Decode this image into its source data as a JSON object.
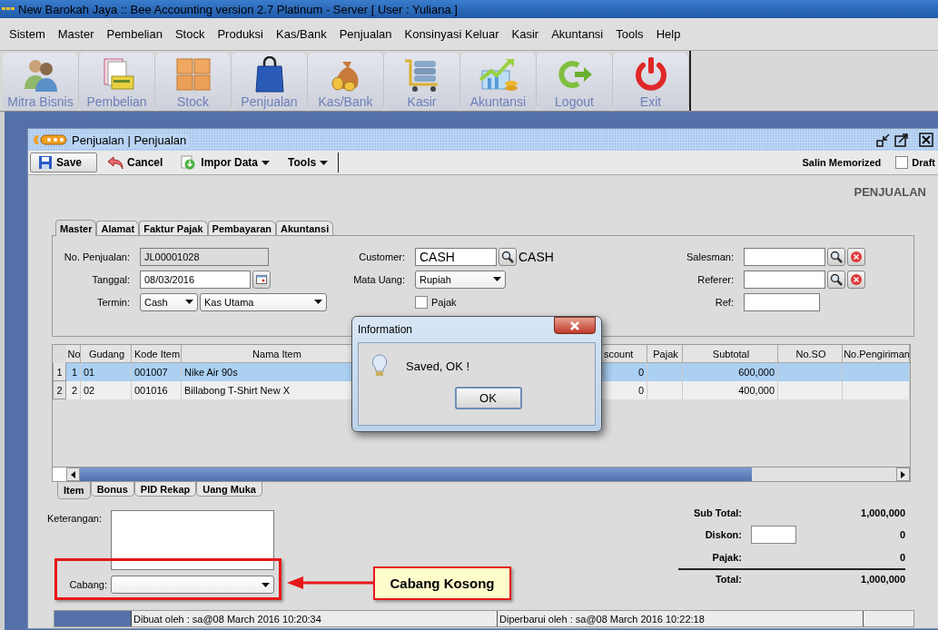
{
  "window": {
    "title": "New Barokah Jaya :: Bee Accounting version 2.7 Platinum - Server  [ User : Yuliana ]"
  },
  "menu": [
    "Sistem",
    "Master",
    "Pembelian",
    "Stock",
    "Produksi",
    "Kas/Bank",
    "Penjualan",
    "Konsinyasi Keluar",
    "Kasir",
    "Akuntansi",
    "Tools",
    "Help"
  ],
  "toolbar": [
    {
      "label": "Mitra Bisnis",
      "kind": "partners"
    },
    {
      "label": "Pembelian",
      "kind": "documents"
    },
    {
      "label": "Stock",
      "kind": "boxes"
    },
    {
      "label": "Penjualan",
      "kind": "bag"
    },
    {
      "label": "Kas/Bank",
      "kind": "money"
    },
    {
      "label": "Kasir",
      "kind": "cart"
    },
    {
      "label": "Akuntansi",
      "kind": "chart"
    },
    {
      "label": "Logout",
      "kind": "logout"
    },
    {
      "label": "Exit",
      "kind": "power"
    }
  ],
  "document": {
    "title": "Penjualan | Penjualan",
    "actions": [
      {
        "label": "Save",
        "kind": "save"
      },
      {
        "label": "Cancel",
        "kind": "cancel"
      },
      {
        "label": "Impor Data",
        "kind": "import"
      },
      {
        "label": "Tools",
        "kind": "menu"
      }
    ],
    "memorized": "Salin Memorized",
    "draft": {
      "label": "Draft",
      "checked": false
    },
    "heading": "PENJUALAN",
    "tabs": [
      {
        "label": "Master",
        "selected": true
      },
      {
        "label": "Alamat",
        "selected": false
      },
      {
        "label": "Faktur Pajak",
        "selected": false
      },
      {
        "label": "Pembayaran",
        "selected": false
      },
      {
        "label": "Akuntansi",
        "selected": false
      }
    ],
    "master": {
      "no_penjualan": {
        "label": "No. Penjualan:",
        "value": "JL00001028"
      },
      "tanggal": {
        "label": "Tanggal:",
        "value": "08/03/2016"
      },
      "termin": {
        "label": "Termin:",
        "value": "Cash",
        "account": "Kas Utama"
      },
      "customer": {
        "label": "Customer:",
        "value": "CASH",
        "name": "CASH"
      },
      "mata_uang": {
        "label": "Mata Uang:",
        "value": "Rupiah"
      },
      "pajak": {
        "label": "Pajak",
        "checked": false
      },
      "salesman": {
        "label": "Salesman:"
      },
      "referer": {
        "label": "Referer:"
      },
      "ref": {
        "label": "Ref:"
      }
    },
    "table": {
      "columns": [
        "No",
        "Gudang",
        "Kode Item",
        "Nama Item",
        "scount",
        "Pajak",
        "Subtotal",
        "No.SO",
        "No.Pengiriman"
      ],
      "rows": [
        {
          "header": "1",
          "selected": true,
          "cells": [
            "1",
            "01",
            "001007",
            "Nike Air 90s",
            "0",
            "",
            "600,000",
            "",
            ""
          ]
        },
        {
          "header": "2",
          "selected": false,
          "cells": [
            "2",
            "02",
            "001016",
            "Billabong T-Shirt New X",
            "0",
            "",
            "400,000",
            "",
            ""
          ]
        }
      ]
    },
    "bottom_tabs": [
      {
        "label": "Item",
        "selected": true
      },
      {
        "label": "Bonus",
        "selected": false
      },
      {
        "label": "PID Rekap",
        "selected": false
      },
      {
        "label": "Uang Muka",
        "selected": false
      }
    ],
    "keterangan": {
      "label": "Keterangan:"
    },
    "cabang": {
      "label": "Cabang:"
    },
    "totals": [
      {
        "label": "Sub Total:",
        "value": "1,000,000",
        "kind": "plain"
      },
      {
        "label": "Diskon:",
        "value": "0",
        "kind": "input"
      },
      {
        "label": "Pajak:",
        "value": "0",
        "kind": "plain"
      },
      {
        "label": "Total:",
        "value": "1,000,000",
        "kind": "total"
      }
    ],
    "status": {
      "created": "Dibuat oleh : sa@08 March 2016  10:20:34",
      "updated": "Diperbarui oleh : sa@08 March 2016  10:22:18"
    }
  },
  "dialog": {
    "title": "Information",
    "message": "Saved, OK !",
    "button": "OK"
  },
  "annotation": {
    "text": "Cabang Kosong"
  }
}
